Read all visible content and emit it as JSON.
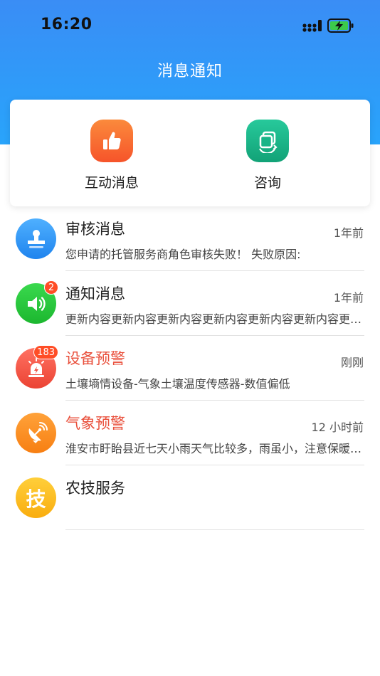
{
  "status_bar": {
    "time": "16:20"
  },
  "header": {
    "title": "消息通知"
  },
  "quick_actions": [
    {
      "label": "互动消息",
      "icon": "thumbs-up-icon",
      "color": "#fb6a2c"
    },
    {
      "label": "咨询",
      "icon": "consult-icon",
      "color": "#1aaf86"
    }
  ],
  "messages": [
    {
      "title": "审核消息",
      "time": "1年前",
      "preview": "您申请的托管服务商角色审核失败！ 失败原因:",
      "icon": "stamp-icon",
      "color": "#2d93f5",
      "badge": ""
    },
    {
      "title": "通知消息",
      "time": "1年前",
      "preview": "更新内容更新内容更新内容更新内容更新内容更新内容更新内容",
      "icon": "speaker-icon",
      "color": "#25c93d",
      "badge": "2"
    },
    {
      "title": "设备预警",
      "time": "刚刚",
      "preview": "土壤墒情设备-气象土壤温度传感器-数值偏低",
      "icon": "alarm-icon",
      "color": "#f0574a",
      "badge": "183"
    },
    {
      "title": "气象预警",
      "time": "12 小时前",
      "preview": "淮安市盱眙县近七天小雨天气比较多，雨虽小，注意保暖防寒",
      "icon": "satellite-dish-icon",
      "color": "#fb8b1f",
      "badge": ""
    },
    {
      "title": "农技服务",
      "time": "",
      "preview": "",
      "icon": "tech-icon",
      "icon_text": "技",
      "color": "#fdbd1e",
      "badge": ""
    }
  ]
}
